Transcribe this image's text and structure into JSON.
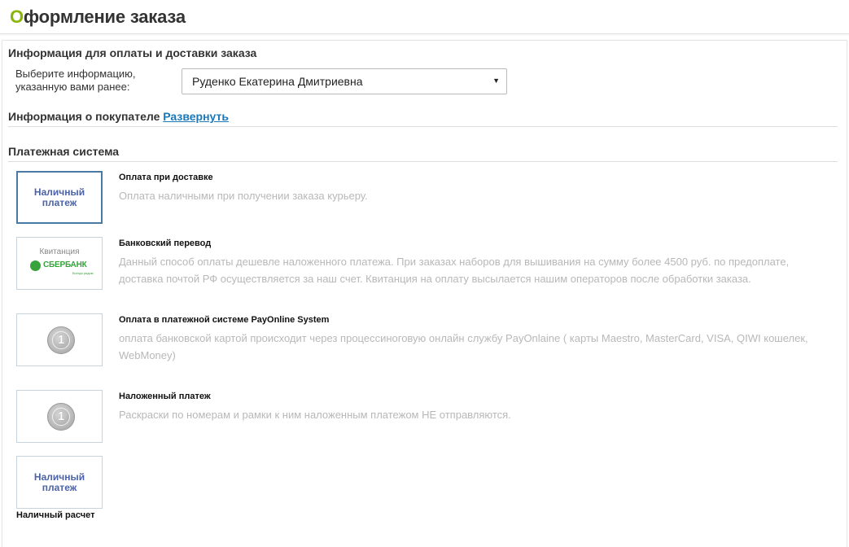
{
  "header": {
    "title_first": "О",
    "title_rest": "формление заказа"
  },
  "info_section": {
    "title": "Информация для оплаты и доставки заказа",
    "select_label": "Выберите информацию, указанную вами ранее:",
    "select_value": "Руденко Екатерина Дмитриевна",
    "arrow_icon": "▼"
  },
  "buyer": {
    "title": "Информация о покупателе",
    "link": "Развернуть"
  },
  "payment": {
    "title": "Платежная система",
    "cash_logo": "Наличный платеж",
    "receipt_label": "Квитанция",
    "sber_name": "СБЕРБАНК",
    "sber_tagline": "Всегда рядом",
    "badge_digit": "1",
    "methods": [
      {
        "name": "Оплата при доставке",
        "desc": "Оплата наличными при получении заказа курьеру."
      },
      {
        "name": "Банковский перевод",
        "desc": "Данный способ оплаты дешевле наложенного платежа. При заказах наборов для вышивания на сумму более 4500 руб. по предоплате, доставка почтой РФ осуществляется за наш счет. Квитанция на оплату высылается нашим операторов после обработки заказа."
      },
      {
        "name": "Оплата в платежной системе PayOnline System",
        "desc": "оплата банковской картой происходит через процессиноговую онлайн службу PayOnlaine ( карты Maestro, MasterCard, VISA, QIWI кошелек, WebMoney)"
      },
      {
        "name": "Наложенный платеж",
        "desc": "Раскраски по номерам и рамки к ним наложенным платежом НЕ отправляются."
      }
    ],
    "last_caption": "Наличный расчет"
  },
  "colors": {
    "accent_green": "#8ab60b",
    "link_blue": "#1a78b8",
    "sber_green": "#36a33b",
    "cash_blue": "#4b62a8"
  }
}
